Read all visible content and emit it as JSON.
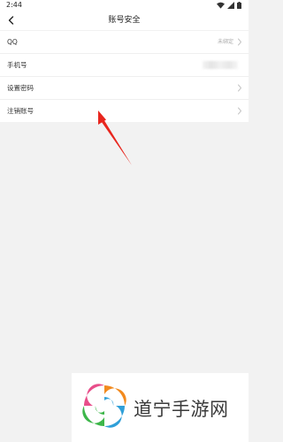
{
  "status_bar": {
    "time": "2:44"
  },
  "header": {
    "title": "账号安全",
    "back_icon": "chevron-left-icon"
  },
  "rows": [
    {
      "label": "QQ",
      "value": "未绑定",
      "icon": "chevron-right-icon"
    },
    {
      "label": "手机号",
      "value": ""
    },
    {
      "label": "设置密码",
      "icon": "chevron-right-icon"
    },
    {
      "label": "注销账号",
      "icon": "chevron-right-icon"
    }
  ],
  "annotation": {
    "color": "#e8261e"
  },
  "watermark": {
    "text": "道宁手游网"
  },
  "colors": {
    "background": "#f2f2f2",
    "surface": "#ffffff",
    "text": "#333333",
    "muted": "#aaaaaa"
  }
}
